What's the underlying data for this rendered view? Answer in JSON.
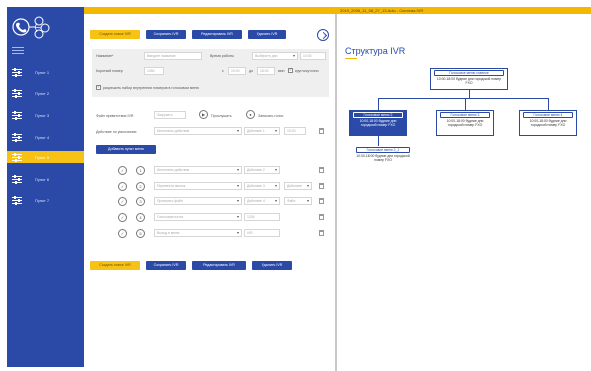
{
  "window_title": "2019_2008_11_08_27_13.Auto - Система IVR",
  "sidebar": {
    "items": [
      {
        "label": "Пункт 1",
        "active": false
      },
      {
        "label": "Пункт 2",
        "active": false
      },
      {
        "label": "Пункт 3",
        "active": false
      },
      {
        "label": "Пункт 4",
        "active": false
      },
      {
        "label": "Пункт 5",
        "active": true
      },
      {
        "label": "Пункт 6",
        "active": false
      },
      {
        "label": "Пункт 7",
        "active": false
      }
    ]
  },
  "toolbar": {
    "create": "Создать новое IVR",
    "save": "Сохранить IVR",
    "edit": "Редактировать IVR",
    "delete": "Удалить IVR"
  },
  "form": {
    "name_label": "Название*",
    "name_placeholder": "Введите название",
    "worktime_label": "Время работы",
    "worktime_value": "Выберите дни",
    "worktime_extra": "10:00",
    "short_number_label": "Короткий номер",
    "short_number_value": "1050",
    "from": "с",
    "time_from": "10:00",
    "to": "до",
    "time_to": "18:00",
    "tz_label": "мин",
    "holiday_label": "круглосуточно",
    "allow_label": "разрешить набор внутренних номеров в голосовом меню"
  },
  "greeting": {
    "label": "Файл приветствия IVR",
    "choose": "Загрузить",
    "listen": "Прослушать",
    "record": "Записать голос"
  },
  "default_action": {
    "label": "Действие по умолчанию",
    "select": "Исполнить действие",
    "target": "Действие 1",
    "extra": "10:00"
  },
  "add_item_button": "Добавить пункт меню",
  "menu_rows": [
    {
      "digit": "1",
      "action": "Исполнить действие",
      "target": "Действие 2",
      "extra": ""
    },
    {
      "digit": "2",
      "action": "Перевести звонок",
      "target": "Действие 3",
      "extra": "Действие"
    },
    {
      "digit": "3",
      "action": "Проиграть файл",
      "target": "Действие 4",
      "extra": "Файл"
    },
    {
      "digit": "4",
      "action": "Голосовая почта",
      "target": "1234",
      "extra": ""
    },
    {
      "digit": "5",
      "action": "Выход в меню",
      "target": "IVR",
      "extra": ""
    }
  ],
  "tree": {
    "title": "Структура IVR",
    "root": {
      "name": "Голосовое меню главное",
      "text": "10:00-18:00 будние дни городской номер FXO"
    },
    "children": [
      {
        "name": "Голосовое меню 2",
        "text": "10:00-18:00 будние дни городской номер FXO",
        "active": true
      },
      {
        "name": "Голосовое меню 3",
        "text": "10:00-18:00 будние дни городской номер FXO",
        "active": false
      },
      {
        "name": "Голосовое меню 4",
        "text": "10:00-18:00 будние дни городской номер FXO",
        "active": false
      }
    ],
    "grandchild": {
      "name": "Голосовое меню 2_1",
      "text": "10:00-18:00 будние дни городской номер FXO"
    }
  }
}
